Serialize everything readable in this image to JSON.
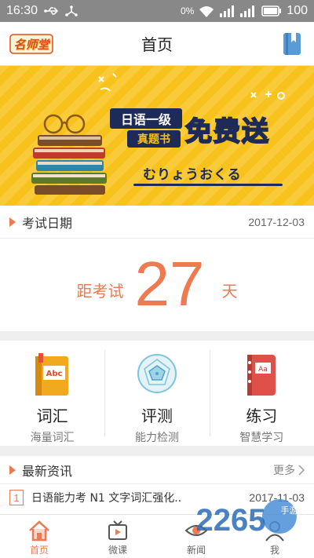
{
  "status": {
    "time": "16:30",
    "speed": "0%",
    "signal_label": "4G",
    "battery": "100"
  },
  "header": {
    "logo_text": "名师堂",
    "title": "首页"
  },
  "banner": {
    "line1": "日语一级",
    "line2": "真题书",
    "headline": "免费送",
    "kana": "むりょうおくる"
  },
  "exam": {
    "label": "考试日期",
    "date": "2017-12-03",
    "countdown_prefix": "距考试",
    "countdown_days": "27",
    "countdown_suffix": "天"
  },
  "features": [
    {
      "name": "词汇",
      "sub": "海量词汇",
      "icon": "vocabulary-book-icon"
    },
    {
      "name": "评测",
      "sub": "能力检测",
      "icon": "radar-chart-icon"
    },
    {
      "name": "练习",
      "sub": "智慧学习",
      "icon": "notebook-icon"
    }
  ],
  "news": {
    "label": "最新资讯",
    "more": "更多",
    "items": [
      {
        "index": "1",
        "title": "日语能力考 N1 文字词汇强化..",
        "date": "2017-11-03"
      }
    ]
  },
  "tabs": [
    {
      "label": "首页",
      "icon": "home-icon",
      "active": true
    },
    {
      "label": "微课",
      "icon": "video-icon",
      "active": false
    },
    {
      "label": "新闻",
      "icon": "eye-icon",
      "active": false
    },
    {
      "label": "我",
      "icon": "user-icon",
      "active": false
    }
  ],
  "watermark": {
    "text": "2265",
    "sub": "手游网"
  },
  "colors": {
    "accent": "#ee7a52",
    "banner_bg": "#f8c21c",
    "banner_navy": "#1e2a58",
    "statusbar": "#888888"
  }
}
